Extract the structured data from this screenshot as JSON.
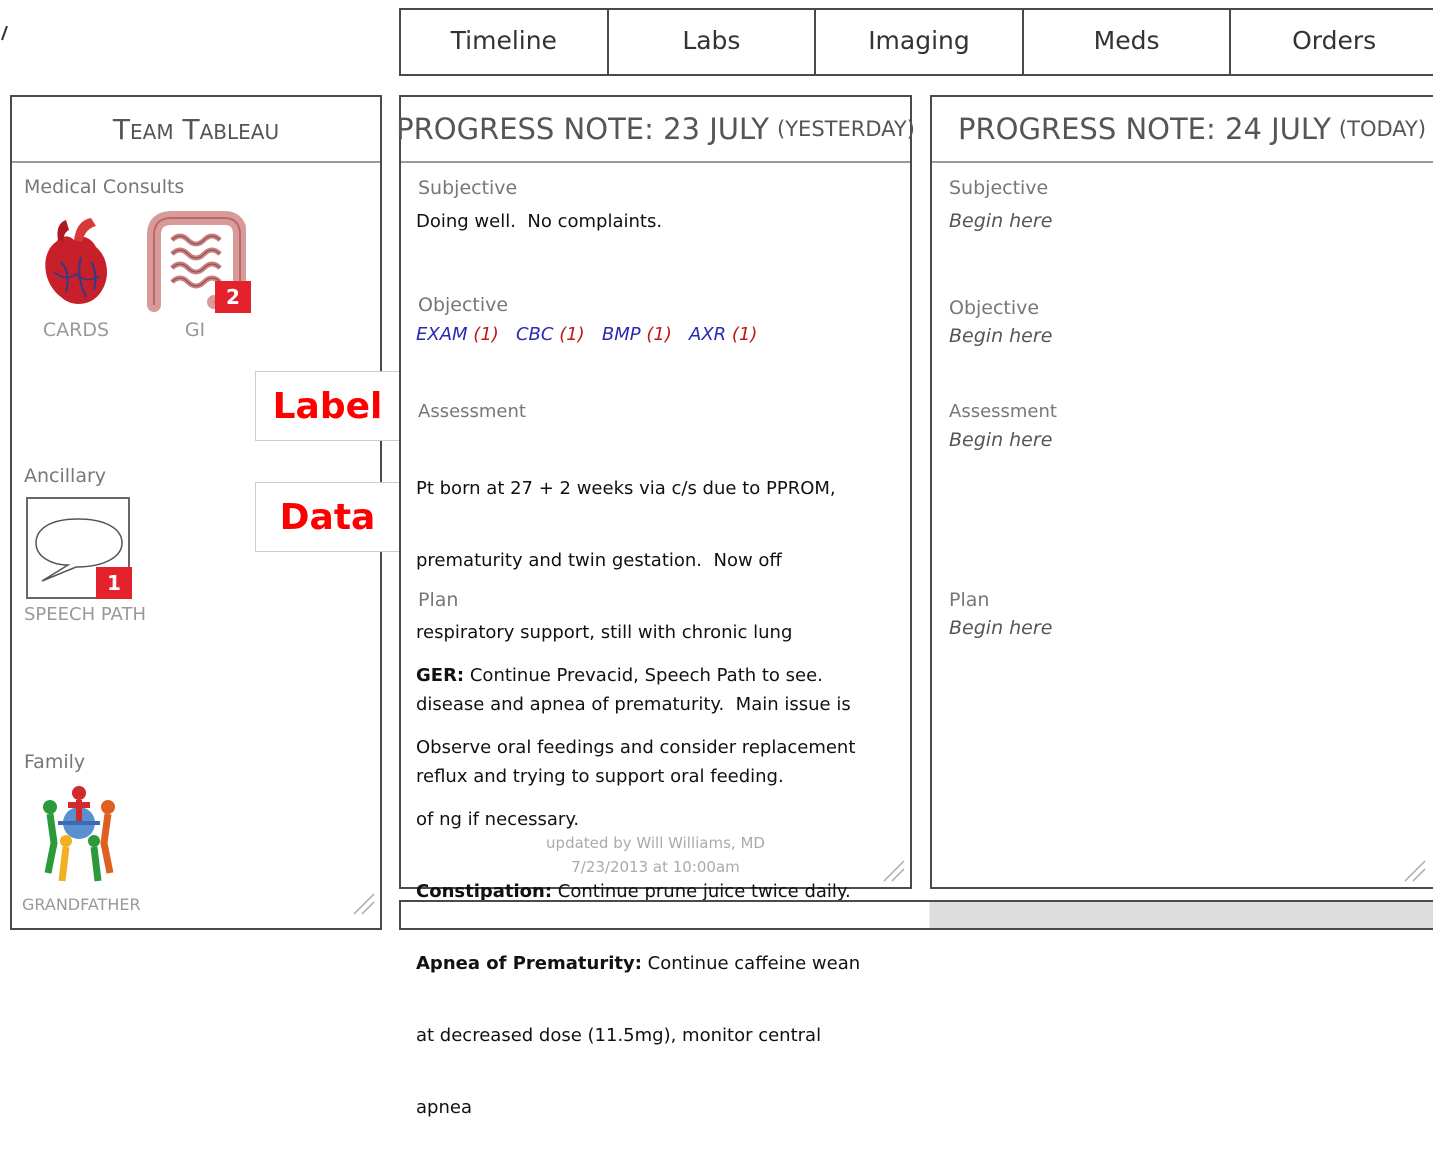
{
  "tabs": [
    "Timeline",
    "Labs",
    "Imaging",
    "Meds",
    "Orders"
  ],
  "team": {
    "title": "Team Tableau",
    "medical_consults": "Medical Consults",
    "cards_label": "CARDS",
    "gi_label": "GI",
    "gi_badge": "2",
    "ancillary": "Ancillary",
    "speech_label": "SPEECH PATH",
    "speech_badge": "1",
    "family": "Family",
    "family_label": "GRANDFATHER"
  },
  "callouts": {
    "label": "Label",
    "data": "Data"
  },
  "note_yesterday": {
    "title": "PROGRESS NOTE: 23 JULY",
    "title_small": "(YESTERDAY)",
    "subjective_label": "Subjective",
    "subjective_text": "Doing well.  No complaints.",
    "objective_label": "Objective",
    "objective_links": [
      {
        "name": "EXAM",
        "count": "(1)"
      },
      {
        "name": "CBC",
        "count": "(1)"
      },
      {
        "name": "BMP",
        "count": "(1)"
      },
      {
        "name": "AXR",
        "count": "(1)"
      }
    ],
    "assessment_label": "Assessment",
    "assessment_lines": [
      "Pt born at 27 + 2 weeks via c/s due to PPROM,",
      "prematurity and twin gestation.  Now off",
      "respiratory support, still with chronic lung",
      "disease and apnea of prematurity.  Main issue is",
      "reflux and trying to support oral feeding."
    ],
    "plan_label": "Plan",
    "plan": {
      "ger_label": "GER:",
      "ger_l1": " Continue Prevacid, Speech Path to see.",
      "ger_l2": "Observe oral feedings and consider replacement",
      "ger_l3": "of ng if necessary.",
      "const_label": "Constipation:",
      "const_text": " Continue prune juice twice daily.",
      "apnea_label": "Apnea of Prematurity:",
      "apnea_l1": " Continue caffeine wean",
      "apnea_l2": "at decreased dose (11.5mg), monitor central",
      "apnea_l3": "apnea"
    },
    "updated_by": "updated by Will Williams, MD",
    "updated_at": "7/23/2013 at 10:00am"
  },
  "note_today": {
    "title": "PROGRESS NOTE: 24 JULY",
    "title_small": "(TODAY)",
    "subjective_label": "Subjective",
    "objective_label": "Objective",
    "assessment_label": "Assessment",
    "plan_label": "Plan",
    "placeholder": "Begin here"
  },
  "colors": {
    "badge": "#e4222c",
    "link": "#2a2ab0",
    "link_count": "#c01818",
    "callout": "#ff0000"
  }
}
